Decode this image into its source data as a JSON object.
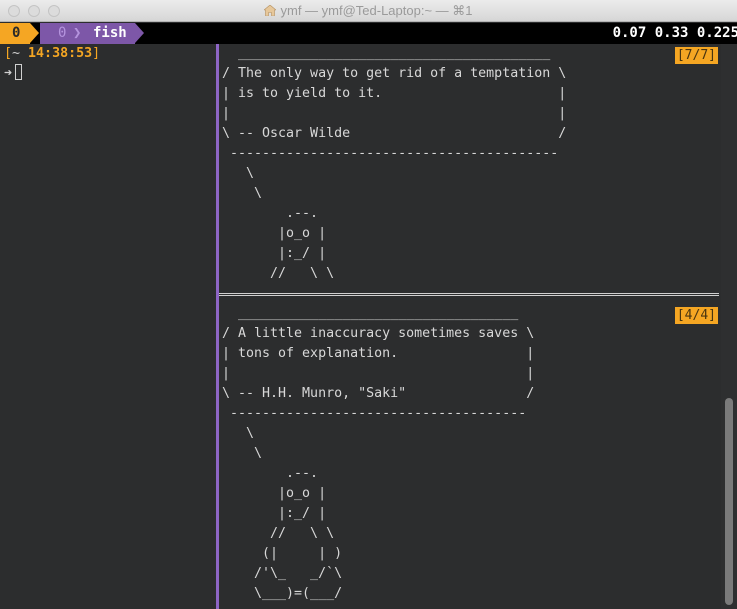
{
  "window": {
    "title": "ymf — ymf@Ted-Laptop:~ — ⌘1",
    "title_icon": "home-icon"
  },
  "tmux": {
    "session_index": "0",
    "active_window": {
      "index": "0",
      "name": "fish"
    },
    "load_average": "0.07 0.33 0.225"
  },
  "left_pane": {
    "prompt_open": "[",
    "prompt_dir": "~",
    "prompt_time": "14:38:53",
    "prompt_close": "]",
    "input_arrow": "➜"
  },
  "top_pane": {
    "position": "[7/7]",
    "cowsay": "  _______________________________________\n/ The only way to get rid of a temptation \\\n| is to yield to it.                      |\n|                                         |\n\\ -- Oscar Wilde                          /\n -----------------------------------------\n   \\\n    \\\n        .--.\n       |o_o |\n       |:_/ |\n      //   \\ \\"
  },
  "bottom_pane": {
    "position": "[4/4]",
    "cowsay": "  ___________________________________\n/ A little inaccuracy sometimes saves \\\n| tons of explanation.                |\n|                                     |\n\\ -- H.H. Munro, \"Saki\"               /\n -------------------------------------\n   \\\n    \\\n        .--.\n       |o_o |\n       |:_/ |\n      //   \\ \\\n     (|     | )\n    /'\\_   _/`\\\n    \\___)=(___/"
  },
  "colors": {
    "accent_orange": "#f5a623",
    "accent_purple": "#7d57a8",
    "pane_border": "#8d65c5",
    "background": "#2c2d2e"
  }
}
